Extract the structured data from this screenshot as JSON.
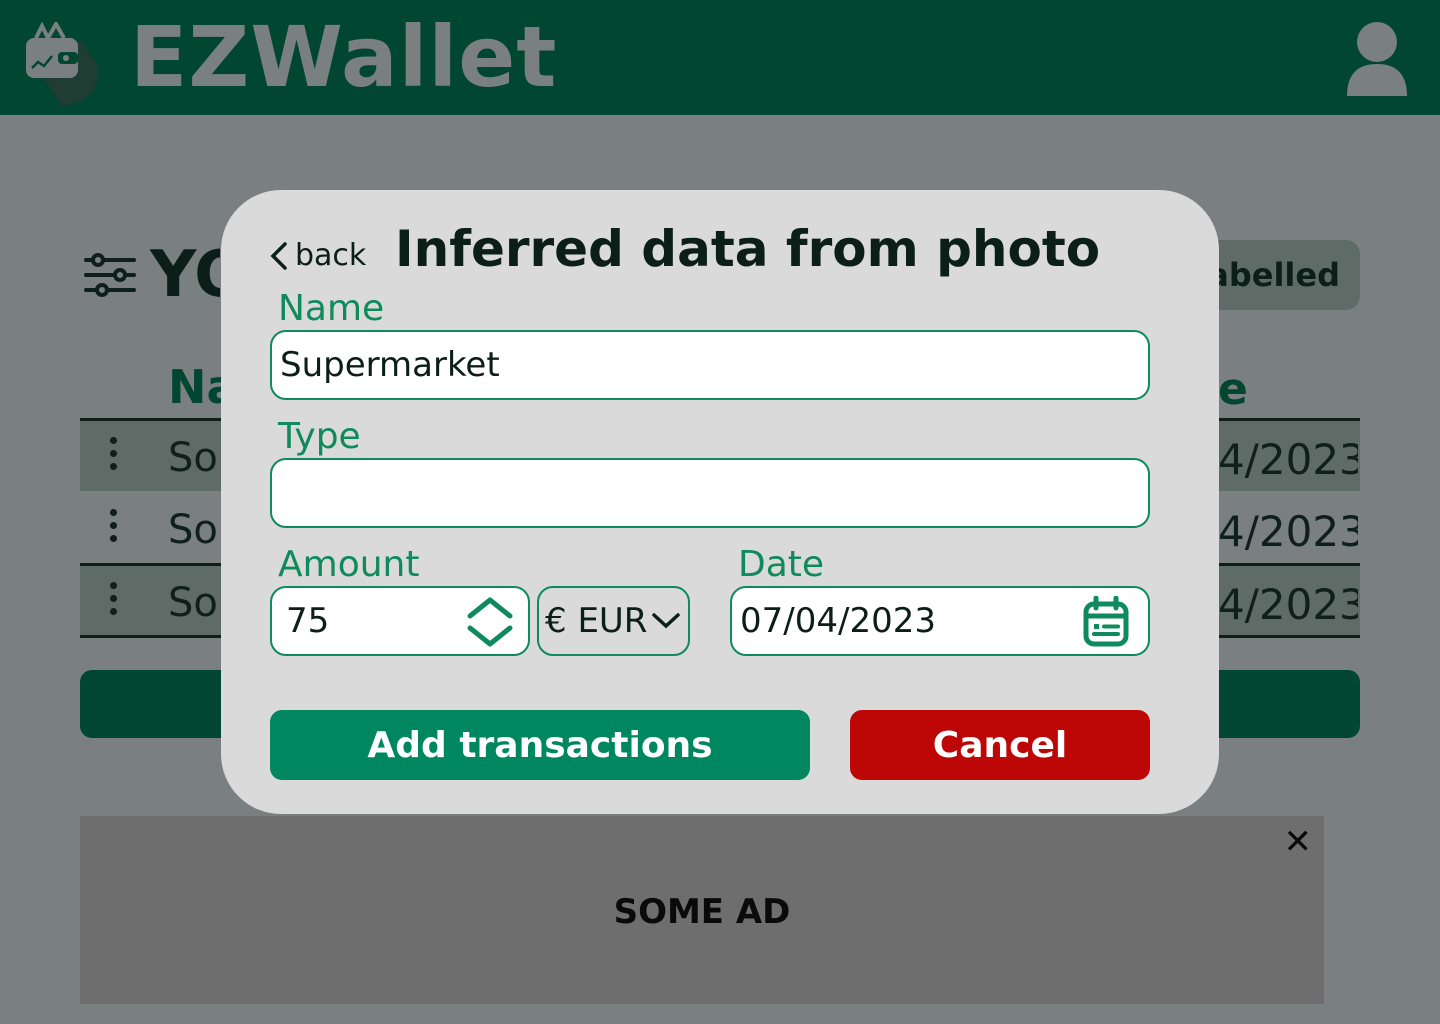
{
  "header": {
    "app_name": "EZWallet",
    "logo_icon": "wallet-logo-icon",
    "profile_icon": "user-icon"
  },
  "background": {
    "heading": "YO",
    "filter_chip": "abelled",
    "column_name": "Na",
    "column_date": "e",
    "rows": [
      {
        "name": "Sor",
        "date": "4/2023"
      },
      {
        "name": "Sor",
        "date": "4/2023"
      },
      {
        "name": "Sor",
        "date": "4/2023"
      }
    ]
  },
  "ad": {
    "text": "SOME AD",
    "close_label": "✕"
  },
  "modal": {
    "back_label": "back",
    "title": "Inferred data from photo",
    "name_label": "Name",
    "name_value": "Supermarket",
    "type_label": "Type",
    "type_value": "",
    "amount_label": "Amount",
    "amount_value": "75",
    "currency_value": "€ EUR",
    "date_label": "Date",
    "date_value": "07/04/2023",
    "add_button": "Add transactions",
    "cancel_button": "Cancel"
  },
  "colors": {
    "primary": "#004631",
    "accent": "#0e8a5e",
    "danger": "#bd0606"
  }
}
